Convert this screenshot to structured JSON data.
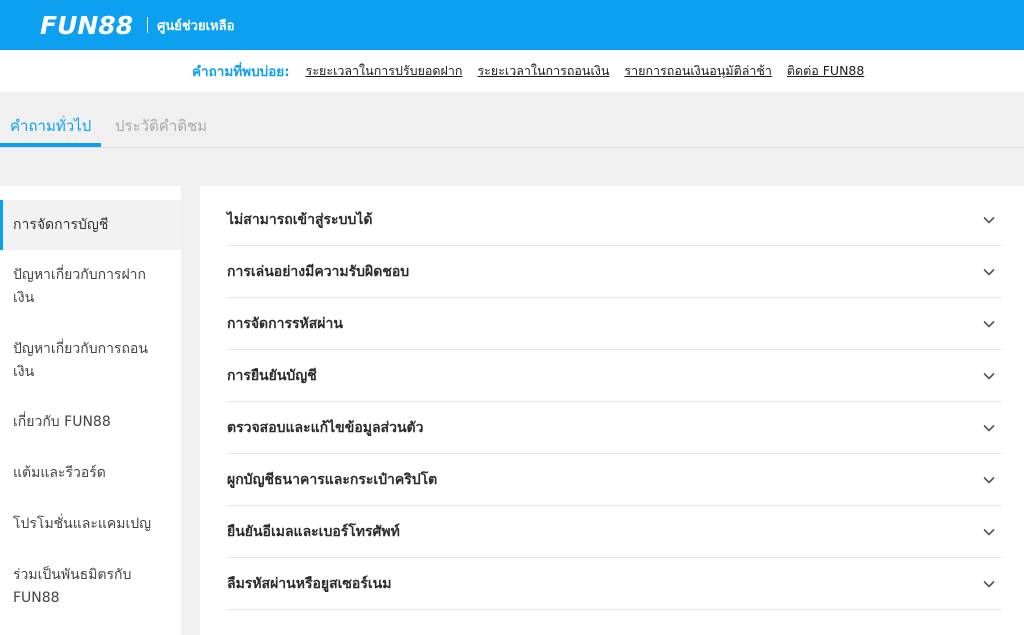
{
  "header": {
    "logo_text": "FUN88",
    "help_center": "ศูนย์ช่วยเหลือ"
  },
  "faq_strip": {
    "label": "คำถามที่พบบ่อย:",
    "links": [
      "ระยะเวลาในการปรับยอดฝาก",
      "ระยะเวลาในการถอนเงิน",
      "รายการถอนเงินอนุมัติล่าช้า",
      "ติดต่อ FUN88"
    ]
  },
  "tabs": [
    {
      "label": "คำถามทั่วไป",
      "active": true
    },
    {
      "label": "ประวัติคำติชม",
      "active": false
    }
  ],
  "sidebar": {
    "items": [
      {
        "label": "การจัดการบัญชี",
        "active": true
      },
      {
        "label": "ปัญหาเกี่ยวกับการฝากเงิน",
        "active": false
      },
      {
        "label": "ปัญหาเกี่ยวกับการถอนเงิน",
        "active": false
      },
      {
        "label": "เกี่ยวกับ FUN88",
        "active": false
      },
      {
        "label": "แต้มและรีวอร์ด",
        "active": false
      },
      {
        "label": "โปรโมชั่นและแคมเปญ",
        "active": false
      },
      {
        "label": "ร่วมเป็นพันธมิตรกับ FUN88",
        "active": false
      }
    ]
  },
  "accordion": {
    "items": [
      "ไม่สามารถเข้าสู่ระบบได้",
      "การเล่นอย่างมีความรับผิดชอบ",
      "การจัดการรหัสผ่าน",
      "การยืนยันบัญชี",
      "ตรวจสอบและแก้ไขข้อมูลส่วนตัว",
      "ผูกบัญชีธนาคารและกระเป๋าคริปโต",
      "ยืนยันอีเมลและเบอร์โทรศัพท์",
      "ลืมรหัสผ่านหรือยูสเซอร์เนม"
    ]
  },
  "icons": {
    "accordion_toggle": "chevron-down-icon"
  },
  "colors": {
    "brand": "#0ea0f0",
    "text_dark": "#2a2a2a",
    "inactive_tab": "#a8a8a8"
  }
}
